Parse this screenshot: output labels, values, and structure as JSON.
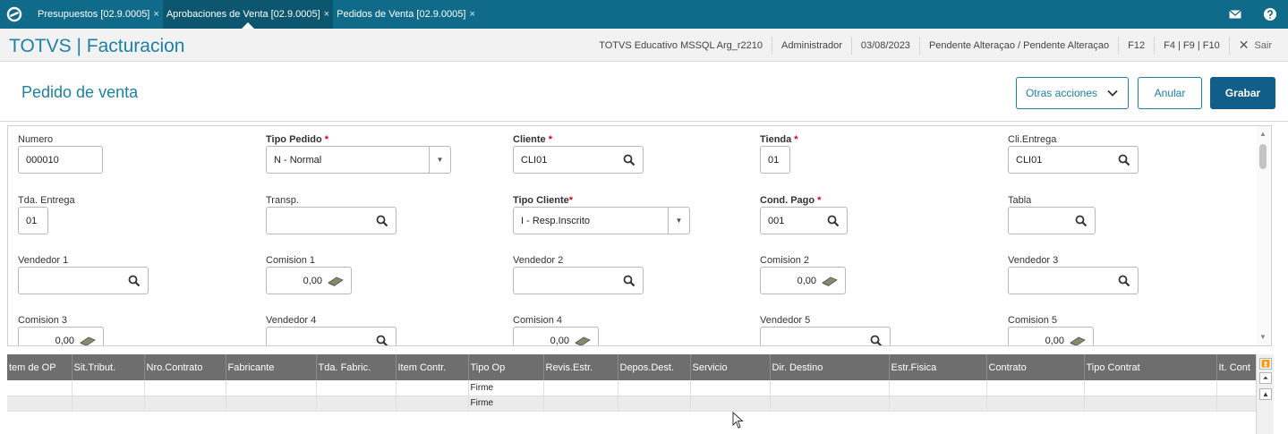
{
  "topbar": {
    "tabs": [
      {
        "label": "Presupuestos [02.9.0005]",
        "close": "×"
      },
      {
        "label": "Aprobaciones de Venta [02.9.0005]",
        "close": "×"
      },
      {
        "label": "Pedidos de Venta [02.9.0005]",
        "close": "×"
      }
    ],
    "active_tab": 1,
    "icons": {
      "logo": "totvs-logo-icon",
      "mail": "mail-icon",
      "help": "help-icon"
    }
  },
  "header": {
    "title": "TOTVS | Facturacion",
    "environment": "TOTVS Educativo MSSQL Arg_r2210",
    "user": "Administrador",
    "date": "03/08/2023",
    "status": "Pendente Alteraçao / Pendente Alteraçao",
    "shortcut_f12": "F12",
    "shortcuts": "F4 | F9 | F10",
    "logout_label": "Sair"
  },
  "page": {
    "title": "Pedido de venta",
    "more_actions_label": "Otras acciones",
    "cancel_label": "Anular",
    "save_label": "Grabar"
  },
  "form": {
    "numero": {
      "label": "Numero",
      "value": "000010"
    },
    "tipo_pedido": {
      "label": "Tipo Pedido",
      "value": "N - Normal"
    },
    "cliente": {
      "label": "Cliente",
      "value": "CLI01"
    },
    "tienda": {
      "label": "Tienda",
      "value": "01"
    },
    "cli_entrega": {
      "label": "Cli.Entrega",
      "value": "CLI01"
    },
    "tda_entrega": {
      "label": "Tda. Entrega",
      "value": "01"
    },
    "transp": {
      "label": "Transp.",
      "value": ""
    },
    "tipo_cliente": {
      "label": "Tipo Cliente",
      "value": "I - Resp.Inscrito"
    },
    "cond_pago": {
      "label": "Cond. Pago",
      "value": "001"
    },
    "tabla": {
      "label": "Tabla",
      "value": ""
    },
    "vendedor1": {
      "label": "Vendedor 1",
      "value": ""
    },
    "comision1": {
      "label": "Comision 1",
      "value": "0,00"
    },
    "vendedor2": {
      "label": "Vendedor 2",
      "value": ""
    },
    "comision2": {
      "label": "Comision 2",
      "value": "0,00"
    },
    "vendedor3": {
      "label": "Vendedor 3",
      "value": ""
    },
    "comision3": {
      "label": "Comision 3",
      "value": "0,00"
    },
    "vendedor4": {
      "label": "Vendedor 4",
      "value": ""
    },
    "comision4": {
      "label": "Comision 4",
      "value": "0,00"
    },
    "vendedor5": {
      "label": "Vendedor 5",
      "value": ""
    },
    "comision5": {
      "label": "Comision 5",
      "value": "0,00"
    },
    "required_mark": "*"
  },
  "grid": {
    "columns": [
      "tem de OP",
      "Sit.Tribut.",
      "Nro.Contrato",
      "Fabricante",
      "Tda. Fabric.",
      "Item Contr.",
      "Tipo Op",
      "Revis.Estr.",
      "Depos.Dest.",
      "Servicio",
      "Dir. Destino",
      "Estr.Fisica",
      "Contrato",
      "Tipo Contrat",
      "It. Cont"
    ],
    "rows": [
      [
        "",
        "",
        "",
        "",
        "",
        "",
        "Firme",
        "",
        "",
        "",
        "",
        "",
        "",
        "",
        ""
      ],
      [
        "",
        "",
        "",
        "",
        "",
        "",
        "Firme",
        "",
        "",
        "",
        "",
        "",
        "",
        "",
        ""
      ]
    ]
  },
  "colors": {
    "topbar": "#106b8b",
    "accent": "#1d80a8",
    "primary_button": "#115e8b",
    "grid_header": "#6e6e6e",
    "required": "#d0021b"
  }
}
